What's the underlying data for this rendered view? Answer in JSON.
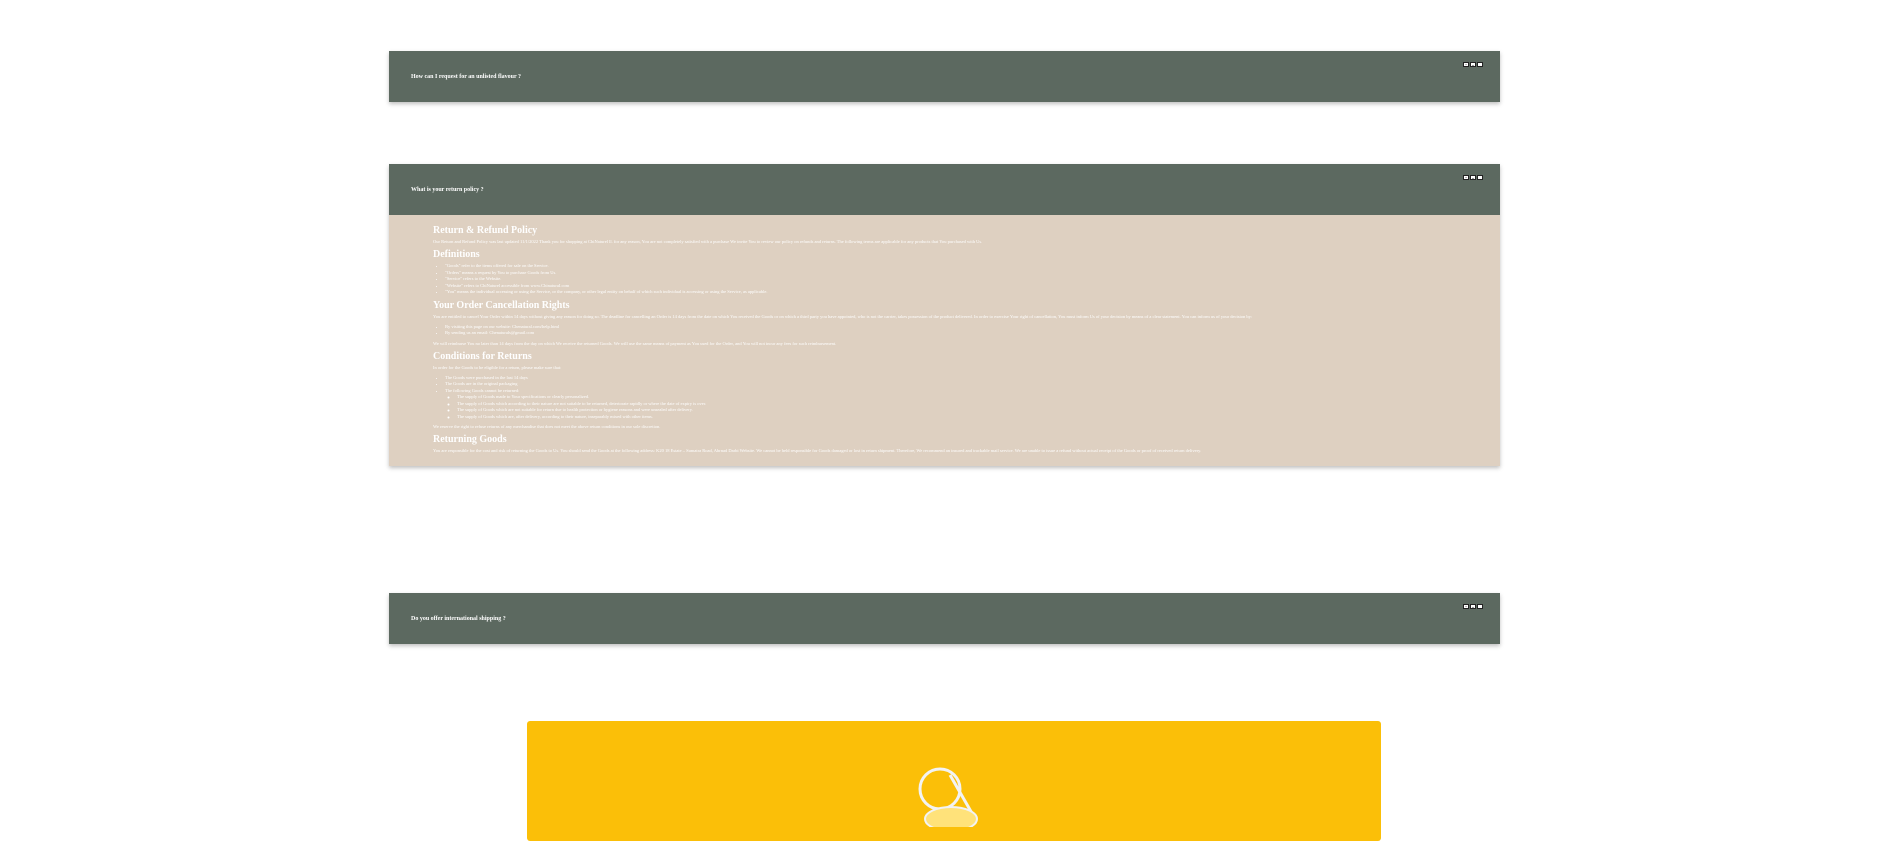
{
  "faq": [
    {
      "question": "How can I request for an unlisted flavour ?",
      "expanded": false
    },
    {
      "question": "What is your return policy ?",
      "expanded": true
    },
    {
      "question": "Do you offer international shipping ?",
      "expanded": false
    }
  ],
  "controls": {
    "collapse": "⌃",
    "up": "▲",
    "down": "⌄"
  },
  "policy": {
    "title": "Return & Refund Policy",
    "intro": "Our Return and Refund Policy was last updated 11/1/2022 Thank you for shopping at ChiNaturel ll. for any reason, You are not completely satisfied with a purchase We invite You to review our policy on refunds and returns. The following terms are applicable for any products that You purchased with Us.",
    "definitions_heading": "Definitions",
    "definitions": [
      "\"Goods\" refer to the items offered for sale on the Service.",
      "\"Orders\" means a request by You to purchase Goods from Us.",
      "\"Service\" refers to the Website.",
      "\"Website\" refers to ChiNaturel accessible from www.ChinaturaI.com",
      "\"You\" means the individual accessing or using the Service, or the company, or other legal entity on behalf of which such individual is accessing or using the Service, as applicable."
    ],
    "cancellation_heading": "Your Order Cancellation Rights",
    "cancellation_text": "You are entitled to cancel Your Order within 14 days without giving any reason for doing so. The deadline for cancelling an Order is 14 days from the date on which You received the Goods or on which a third party you have appointed, who is not the carrier, takes possession of the product delivered. In order to exercise Your right of cancellation, You must inform Us of your decision by means of a clear statement. You can inform us of your decision by:",
    "cancellation_methods": [
      "By visiting this page on our website: Chenatural.com/help.html",
      "By sending us an email: Chenaturals@gmail.com"
    ],
    "reimburse_text": "We will reimburse You no later than 14 days from the day on which We receive the returned Goods. We will use the same means of payment as You used for the Order, and You will not incur any fees for such reimbursement.",
    "conditions_heading": "Conditions for Returns",
    "conditions_intro": "In order for the Goods to be eligible for a return, please make sure that:",
    "conditions": [
      "The Goods were purchased in the last 14 days",
      "The Goods are in the original packaging",
      "The following Goods cannot be returned:"
    ],
    "exclusions": [
      "The supply of Goods made to Your specifications or clearly personalized.",
      "The supply of Goods which according to their nature are not suitable to be returned, deteriorate rapidly or where the date of expiry is over.",
      "The supply of Goods which are not suitable for return due to health protection or hygiene reasons and were unsealed after delivery.",
      "The supply of Goods which are, after delivery, according to their nature, inseparably mixed with other items."
    ],
    "reserve_text": "We reserve the right to refuse returns of any merchandise that does not meet the above return conditions in our sole discretion.",
    "returning_heading": "Returning Goods",
    "returning_text": "You are responsible for the cost and risk of returning the Goods to Us. You should send the Goods at the following address: K20 18 Estate – Sumatra Road, Abrnad Darbi Website. We cannot be held responsible for Goods damaged or lost in return shipment. Therefore, We recommend an insured and trackable mail service. We are unable to issue a refund without actual receipt of the Goods or proof of received return delivery."
  },
  "hero": {
    "background": "#fbbf08"
  },
  "colors": {
    "header": "#5c6960",
    "body": "#ded0c1"
  }
}
